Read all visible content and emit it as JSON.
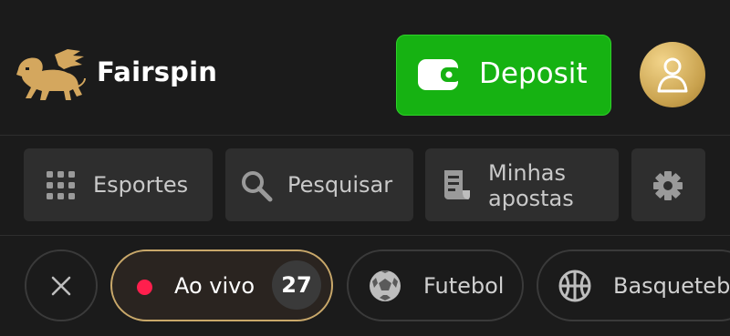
{
  "header": {
    "brand": "Fairspin",
    "logo_icon": "winged-lion-icon",
    "deposit_label": "Deposit",
    "deposit_icon": "wallet-icon",
    "avatar_icon": "user-icon",
    "colors": {
      "deposit_bg": "#16b212",
      "logo_gold": "#d4a75e",
      "avatar_gold": "#c9a24e"
    }
  },
  "nav": {
    "sports_label": "Esportes",
    "sports_icon": "grid-icon",
    "search_label": "Pesquisar",
    "search_icon": "search-icon",
    "bets_line1": "Minhas",
    "bets_line2": "apostas",
    "bets_icon": "receipt-icon",
    "settings_icon": "gear-icon"
  },
  "filters": {
    "close_icon": "close-icon",
    "live_label": "Ao vivo",
    "live_count": "27",
    "live_dot_color": "#ff1f4d",
    "football_label": "Futebol",
    "football_icon": "soccer-ball-icon",
    "basketball_label": "Basquetebol",
    "basketball_icon": "basketball-icon"
  }
}
